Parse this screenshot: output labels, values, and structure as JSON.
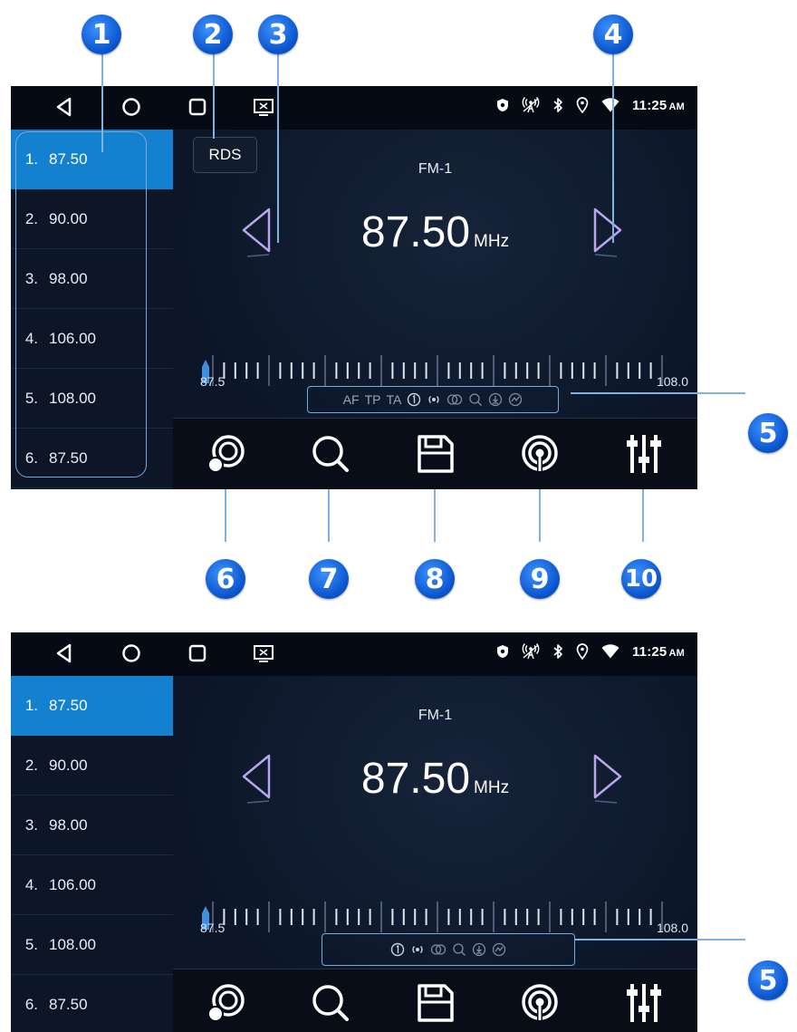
{
  "callouts": {
    "c1": "1",
    "c2": "2",
    "c3": "3",
    "c4": "4",
    "c5a": "5",
    "c6": "6",
    "c7": "7",
    "c8": "8",
    "c9": "9",
    "c10": "10",
    "c5b": "5"
  },
  "status": {
    "time": "11:25",
    "ampm": "AM"
  },
  "screen1": {
    "rds_label": "RDS",
    "band": "FM-1",
    "frequency": "87.50",
    "unit": "MHz",
    "scale_min": "87.5",
    "scale_max": "108.0",
    "flags": [
      "AF",
      "TP",
      "TA"
    ],
    "presets": [
      {
        "num": "1.",
        "freq": "87.50"
      },
      {
        "num": "2.",
        "freq": "90.00"
      },
      {
        "num": "3.",
        "freq": "98.00"
      },
      {
        "num": "4.",
        "freq": "106.00"
      },
      {
        "num": "5.",
        "freq": "108.00"
      },
      {
        "num": "6.",
        "freq": "87.50"
      }
    ]
  },
  "screen2": {
    "band": "FM-1",
    "frequency": "87.50",
    "unit": "MHz",
    "scale_min": "87.5",
    "scale_max": "108.0",
    "presets": [
      {
        "num": "1.",
        "freq": "87.50"
      },
      {
        "num": "2.",
        "freq": "90.00"
      },
      {
        "num": "3.",
        "freq": "98.00"
      },
      {
        "num": "4.",
        "freq": "106.00"
      },
      {
        "num": "5.",
        "freq": "108.00"
      },
      {
        "num": "6.",
        "freq": "87.50"
      }
    ]
  },
  "icons": {
    "nav": [
      "back-icon",
      "home-icon",
      "recent-apps-icon",
      "screen-icon"
    ],
    "status": [
      "shield-icon",
      "radio-signal-icon",
      "bluetooth-icon",
      "location-icon",
      "wifi-icon"
    ],
    "toolbar": [
      "band-switch-icon",
      "search-icon",
      "save-icon",
      "broadcast-icon",
      "equalizer-icon"
    ]
  },
  "colors": {
    "accent": "#1380d0",
    "callout": "#0b56cf",
    "screen_bg": "#0b1425"
  }
}
